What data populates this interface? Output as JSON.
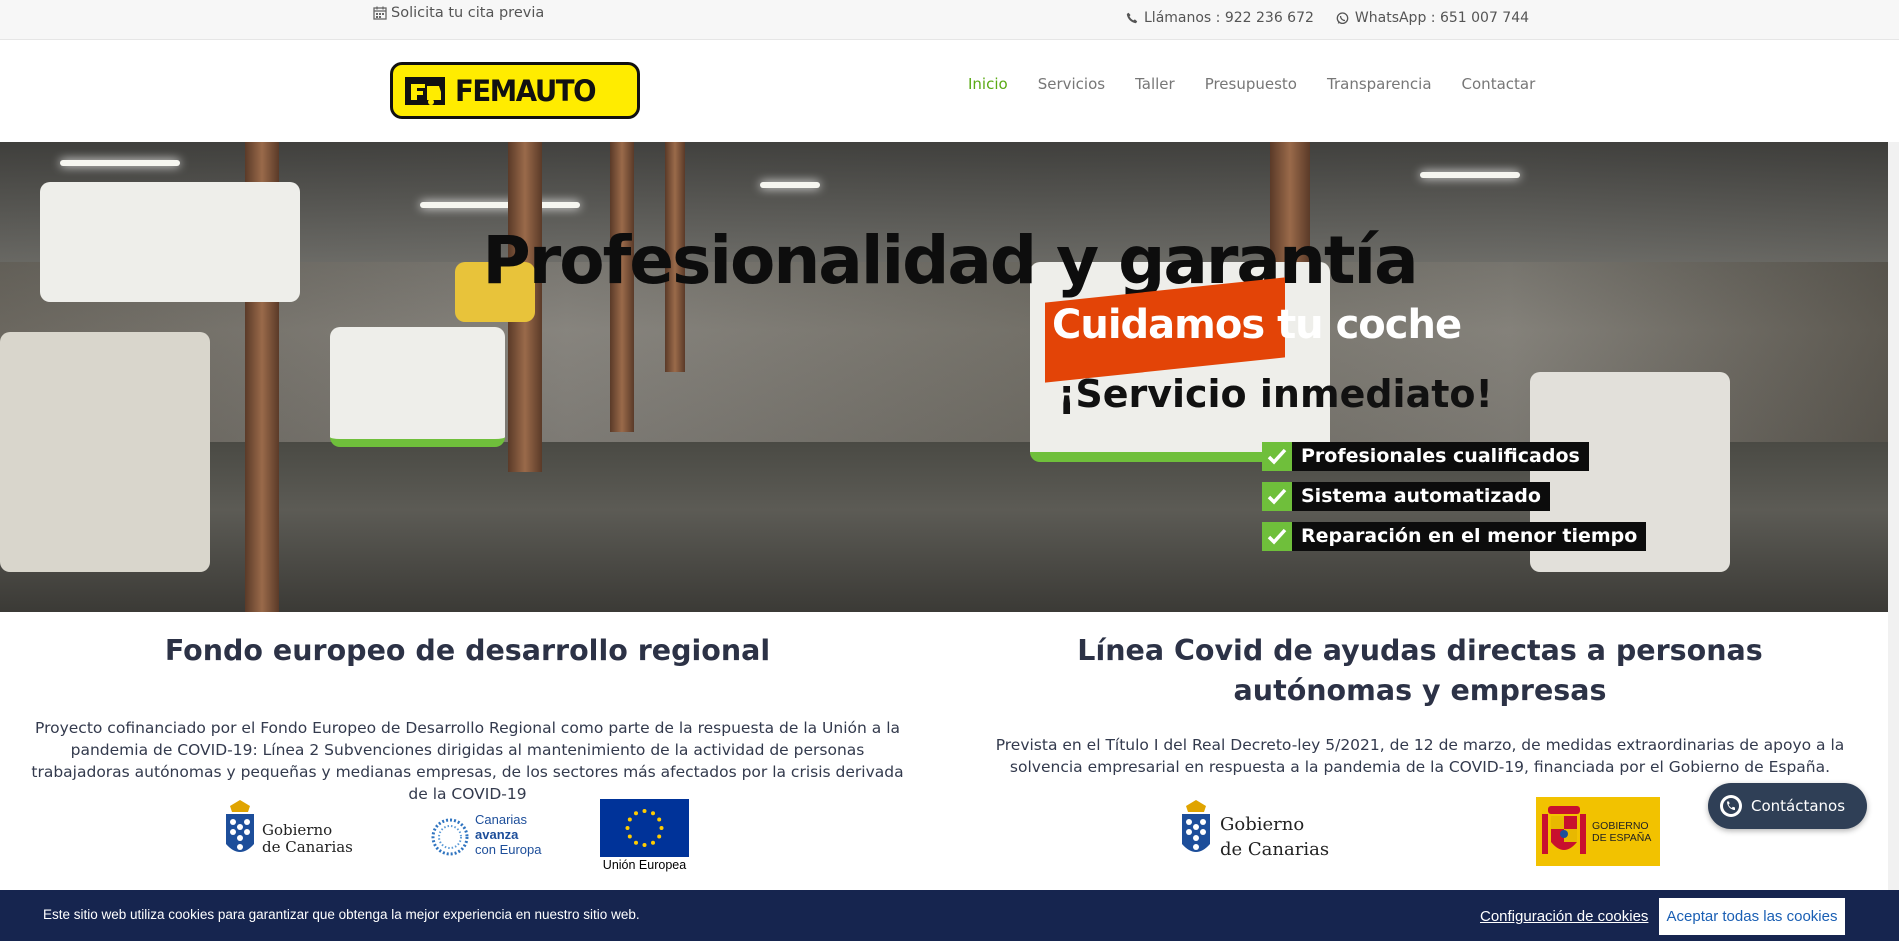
{
  "topbar": {
    "cita": "Solicita tu cita previa",
    "phone": "Llámanos : 922 236 672",
    "whatsapp": "WhatsApp : 651 007 744"
  },
  "header": {
    "logo_text": "FEMAUTO",
    "nav": [
      "Inicio",
      "Servicios",
      "Taller",
      "Presupuesto",
      "Transparencia",
      "Contactar"
    ],
    "active_nav": "Inicio"
  },
  "hero": {
    "title": "Profesionalidad y garantía",
    "subtitle": "Cuidamos tu coche",
    "tagline": "¡Servicio inmediato!",
    "features": [
      "Profesionales cualificados",
      "Sistema automatizado",
      "Reparación en el menor tiempo"
    ]
  },
  "funding": {
    "left": {
      "title": "Fondo europeo de desarrollo regional",
      "text": "Proyecto cofinanciado por el Fondo Europeo de Desarrollo Regional como parte de la respuesta de la Unión a la pandemia de COVID-19: Línea 2 Subvenciones dirigidas al mantenimiento de la actividad de personas trabajadoras autónomas y pequeñas y medianas empresas, de los sectores más afectados por la crisis derivada de la COVID-19",
      "logos": {
        "gobierno_canarias": [
          "Gobierno",
          "de Canarias"
        ],
        "canarias_avanza": [
          "Canarias",
          "avanza",
          "con Europa"
        ],
        "union_europea": "Unión Europea"
      }
    },
    "right": {
      "title": "Línea Covid de ayudas directas a personas autónomas y empresas",
      "text": "Prevista en el Título I del Real Decreto-ley 5/2021, de 12 de marzo, de medidas extraordinarias de apoyo a la solvencia empresarial en respuesta a la pandemia de la COVID-19, financiada por el Gobierno de España.",
      "logos": {
        "gobierno_canarias": [
          "Gobierno",
          "de Canarias"
        ],
        "gobierno_espana": [
          "GOBIERNO",
          "DE ESPAÑA"
        ]
      }
    }
  },
  "whatsapp_button": "Contáctanos",
  "cookie": {
    "text": "Este sitio web utiliza cookies para garantizar que obtenga la mejor experiencia en nuestro sitio web.",
    "config": "Configuración de cookies",
    "accept": "Aceptar todas las cookies"
  },
  "colors": {
    "nav_active": "#5aaa14",
    "logo_yellow": "#ffec00",
    "hero_red": "#e34407",
    "check_green": "#6fbf3b",
    "cookie_bg": "#16254f",
    "heading": "#2c3246"
  }
}
